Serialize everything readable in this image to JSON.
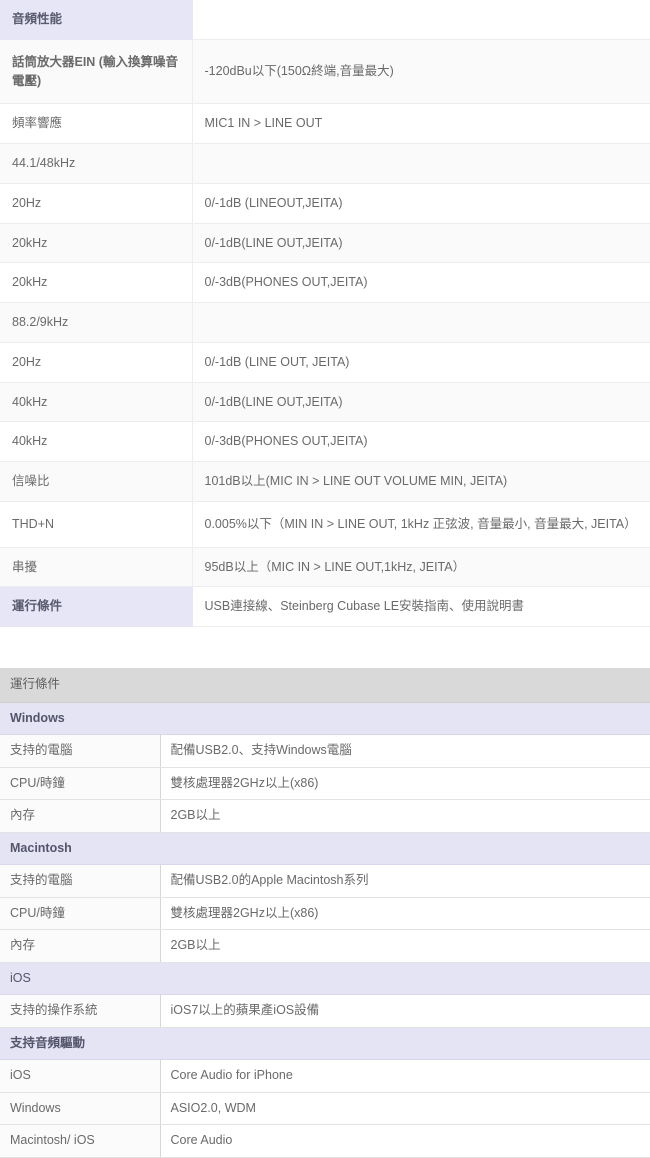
{
  "audio_spec_table": {
    "rows": [
      {
        "type": "header",
        "key": "音頻性能",
        "value": ""
      },
      {
        "type": "bold",
        "key": "話筒放大器EIN (輸入換算噪音電壓)",
        "value": "-120dBu以下(150Ω終端,音量最大)"
      },
      {
        "type": "plain",
        "key": "頻率響應",
        "value": "MIC1 IN > LINE OUT"
      },
      {
        "type": "plain",
        "key": "44.1/48kHz",
        "value": ""
      },
      {
        "type": "plain",
        "key": "20Hz",
        "value": "0/-1dB (LINEOUT,JEITA)"
      },
      {
        "type": "plain",
        "key": "20kHz",
        "value": "0/-1dB(LINE OUT,JEITA)"
      },
      {
        "type": "plain",
        "key": "20kHz",
        "value": "0/-3dB(PHONES OUT,JEITA)"
      },
      {
        "type": "plain",
        "key": "88.2/9kHz",
        "value": ""
      },
      {
        "type": "plain",
        "key": "20Hz",
        "value": "0/-1dB (LINE OUT, JEITA)"
      },
      {
        "type": "plain",
        "key": "40kHz",
        "value": "0/-1dB(LINE OUT,JEITA)"
      },
      {
        "type": "plain",
        "key": "40kHz",
        "value": "0/-3dB(PHONES OUT,JEITA)"
      },
      {
        "type": "plain",
        "key": "信噪比",
        "value": "101dB以上(MIC IN > LINE OUT VOLUME MIN, JEITA)"
      },
      {
        "type": "plain",
        "key": "THD+N",
        "value": "0.005%以下（MIN IN > LINE OUT, 1kHz 正弦波, 音量最小, 音量最大, JEITA）"
      },
      {
        "type": "plain",
        "key": "串擾",
        "value": "95dB以上（MIC IN > LINE OUT,1kHz, JEITA）"
      },
      {
        "type": "header2",
        "key": "運行條件",
        "value": "USB連接線、Steinberg Cubase LE安裝指南、使用說明書"
      }
    ]
  },
  "requirements_table": {
    "rows": [
      {
        "type": "title",
        "key": "運行條件",
        "value": ""
      },
      {
        "type": "section",
        "key": "Windows",
        "value": ""
      },
      {
        "type": "data",
        "key": "支持的電腦",
        "value": "配備USB2.0、支持Windows電腦"
      },
      {
        "type": "data",
        "key": "CPU/時鐘",
        "value": "雙核處理器2GHz以上(x86)"
      },
      {
        "type": "data",
        "key": "內存",
        "value": "2GB以上"
      },
      {
        "type": "section",
        "key": "Macintosh",
        "value": ""
      },
      {
        "type": "data",
        "key": "支持的電腦",
        "value": "配備USB2.0的Apple Macintosh系列"
      },
      {
        "type": "data",
        "key": "CPU/時鐘",
        "value": "雙核處理器2GHz以上(x86)"
      },
      {
        "type": "data",
        "key": "內存",
        "value": "2GB以上"
      },
      {
        "type": "section-plain",
        "key": "iOS",
        "value": ""
      },
      {
        "type": "data",
        "key": "支持的操作系統",
        "value": "iOS7以上的蘋果產iOS設備"
      },
      {
        "type": "section",
        "key": "支持音頻驅動",
        "value": ""
      },
      {
        "type": "data",
        "key": "iOS",
        "value": "Core Audio for iPhone"
      },
      {
        "type": "data",
        "key": "Windows",
        "value": "ASIO2.0, WDM"
      },
      {
        "type": "data",
        "key": "Macintosh/ iOS",
        "value": "Core Audio"
      }
    ]
  },
  "colors": {
    "header_lavender": "#e6e6f7",
    "section_lavender": "#e4e4f5",
    "title_gray": "#d9d9d9",
    "row_alt": "#fafafa",
    "text": "#6a6a6a",
    "border": "#ededed"
  }
}
